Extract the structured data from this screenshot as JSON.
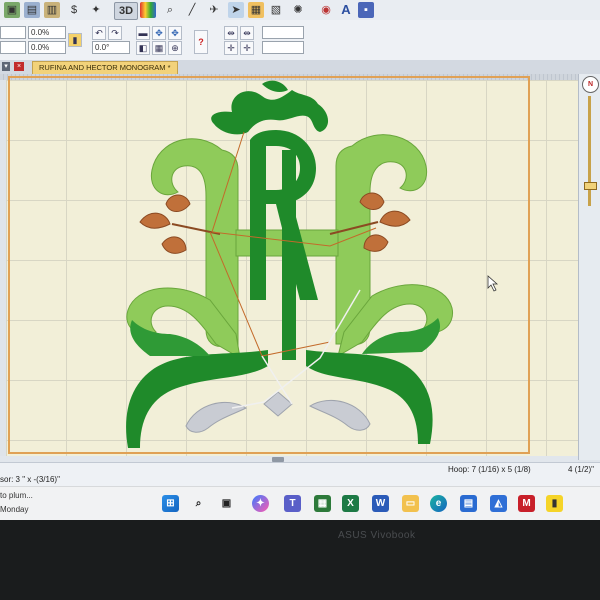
{
  "toolbar": {
    "view_3d_label": "3D",
    "font_tool_label": "A"
  },
  "fields": {
    "width_pct": "0.0%",
    "height_pct": "0.0%",
    "rotation": "0.0°"
  },
  "document": {
    "tab_title": "RUFINA AND HECTOR MONOGRAM *"
  },
  "ruler_compass_label": "N",
  "status": {
    "cursor": "sor: 3 \" x -(3/16)\"",
    "hoop": "Hoop: 7 (1/16) x 5 (1/8)",
    "page": "4 (1/2)\""
  },
  "taskbar": {
    "notification_line1": "to plum...",
    "notification_line2": "Monday"
  },
  "laptop_brand": "ASUS Vivobook",
  "colors": {
    "dark_green": "#1f8a2a",
    "light_green": "#8fcb5a",
    "rust_leaf": "#c0703a",
    "silver": "#c9ccd3",
    "hoop_border": "#e0a155"
  }
}
